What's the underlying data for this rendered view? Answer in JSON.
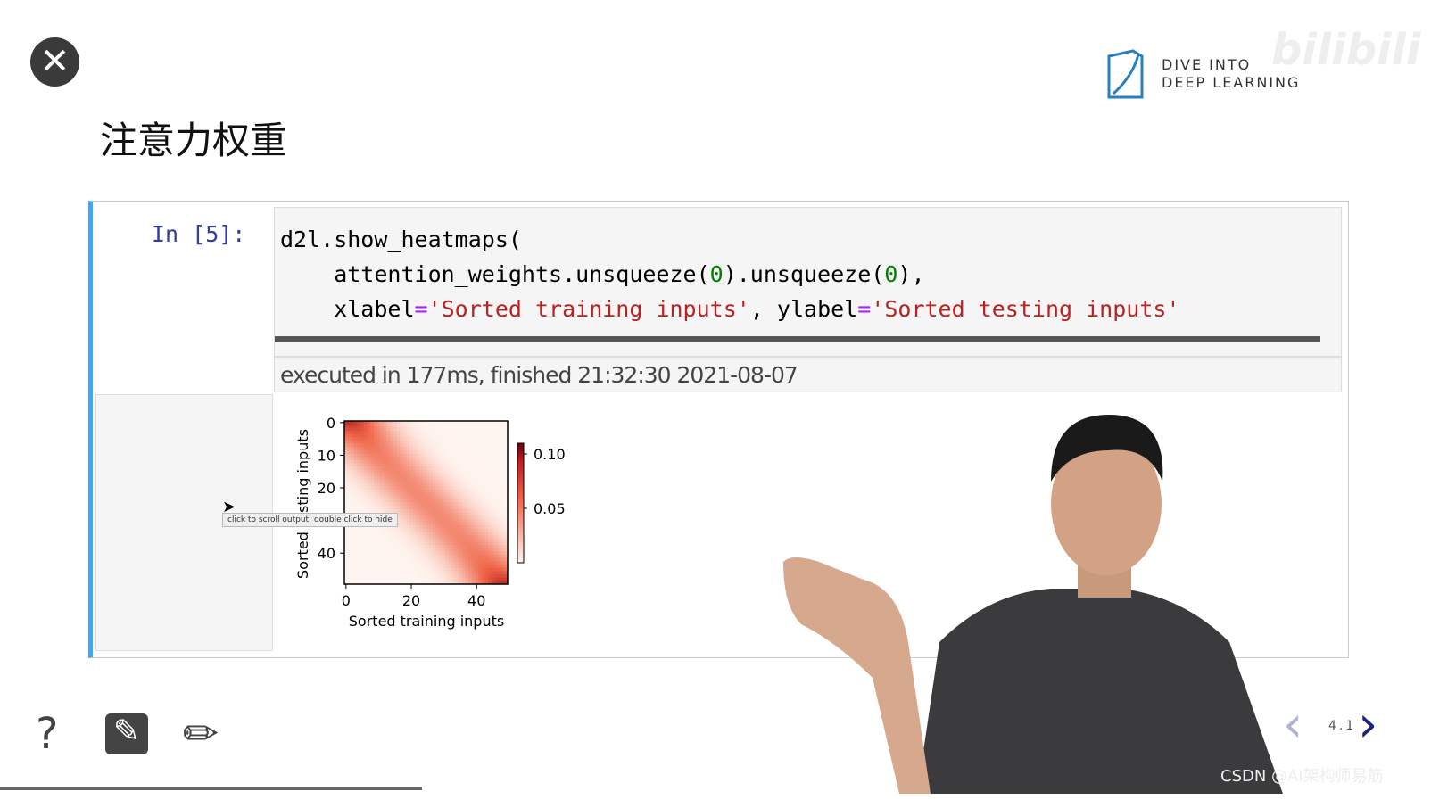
{
  "slide": {
    "title": "注意力权重",
    "page": "4.1"
  },
  "logo": {
    "line1": "DIVE INTO",
    "line2": "DEEP LEARNING",
    "watermark": "bilibili"
  },
  "cell": {
    "prompt": "In [5]:",
    "code_line1": "d2l.show_heatmaps(",
    "code_line2_a": "    attention_weights.unsqueeze(",
    "code_zero": "0",
    "code_line2_b": ").unsqueeze(",
    "code_line2_c": "),",
    "code_line3_a": "    xlabel",
    "eq": "=",
    "xlabel_str": "'Sorted training inputs'",
    "comma": ", ylabel",
    "ylabel_str": "'Sorted testing inputs'",
    "exec_info": "executed in 177ms, finished 21:32:30 2021-08-07",
    "tooltip": "click to scroll output; double click to hide"
  },
  "chart_data": {
    "type": "heatmap",
    "xlabel": "Sorted training inputs",
    "ylabel": "Sorted testing inputs",
    "xlim": [
      0,
      50
    ],
    "ylim": [
      0,
      50
    ],
    "xticks": [
      "0",
      "20",
      "40"
    ],
    "yticks": [
      "0",
      "10",
      "20",
      "40"
    ],
    "colormap": "Reds",
    "colorbar": {
      "ticks": [
        "0.10",
        "0.05"
      ],
      "range": [
        0,
        0.11
      ]
    },
    "pattern": "diagonal band of high weight, strongest at top-left and bottom-right corners"
  },
  "toolbar": {
    "help": "?",
    "edit": "✎",
    "pencil": "✏"
  },
  "nav": {
    "prev": "‹",
    "next": "›"
  },
  "watermark": "CSDN @AI架构师易筋",
  "colors": {
    "accent": "#42a5f5",
    "nav": "#1a237e"
  }
}
